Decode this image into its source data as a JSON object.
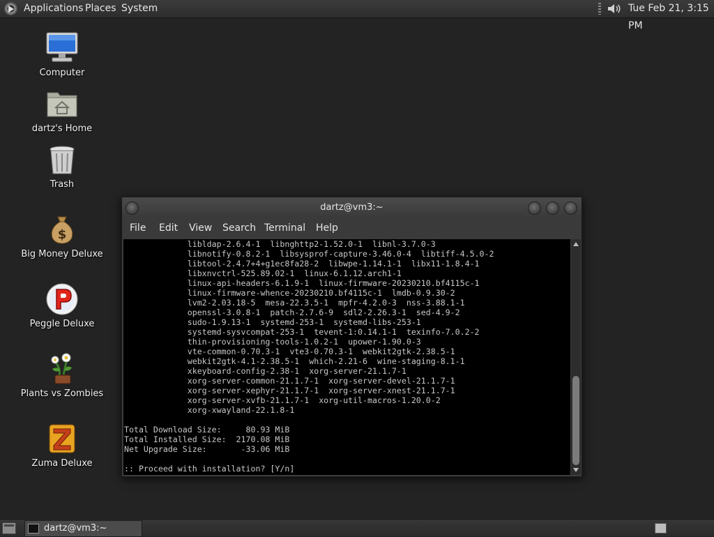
{
  "top_panel": {
    "menu": [
      "Applications",
      "Places",
      "System"
    ],
    "clock": "Tue Feb 21,  3:15 PM"
  },
  "desktop": {
    "icons": [
      {
        "label": "Computer",
        "icon": "computer-icon"
      },
      {
        "label": "dartz's Home",
        "icon": "home-folder-icon"
      },
      {
        "label": "Trash",
        "icon": "trash-icon"
      },
      {
        "label": "Big Money Deluxe",
        "icon": "money-bag-icon"
      },
      {
        "label": "Peggle Deluxe",
        "icon": "peggle-icon"
      },
      {
        "label": "Plants vs Zombies",
        "icon": "plants-vs-zombies-icon"
      },
      {
        "label": "Zuma Deluxe",
        "icon": "zuma-icon"
      }
    ]
  },
  "terminal": {
    "title": "dartz@vm3:~",
    "menu": [
      "File",
      "Edit",
      "View",
      "Search",
      "Terminal",
      "Help"
    ],
    "lines": [
      "             libldap-2.6.4-1  libnghttp2-1.52.0-1  libnl-3.7.0-3",
      "             libnotify-0.8.2-1  libsysprof-capture-3.46.0-4  libtiff-4.5.0-2",
      "             libtool-2.4.7+4+g1ec8fa28-2  libwpe-1.14.1-1  libx11-1.8.4-1",
      "             libxnvctrl-525.89.02-1  linux-6.1.12.arch1-1",
      "             linux-api-headers-6.1.9-1  linux-firmware-20230210.bf4115c-1",
      "             linux-firmware-whence-20230210.bf4115c-1  lmdb-0.9.30-2",
      "             lvm2-2.03.18-5  mesa-22.3.5-1  mpfr-4.2.0-3  nss-3.88.1-1",
      "             openssl-3.0.8-1  patch-2.7.6-9  sdl2-2.26.3-1  sed-4.9-2",
      "             sudo-1.9.13-1  systemd-253-1  systemd-libs-253-1",
      "             systemd-sysvcompat-253-1  tevent-1:0.14.1-1  texinfo-7.0.2-2",
      "             thin-provisioning-tools-1.0.2-1  upower-1.90.0-3",
      "             vte-common-0.70.3-1  vte3-0.70.3-1  webkit2gtk-2.38.5-1",
      "             webkit2gtk-4.1-2.38.5-1  which-2.21-6  wine-staging-8.1-1",
      "             xkeyboard-config-2.38-1  xorg-server-21.1.7-1",
      "             xorg-server-common-21.1.7-1  xorg-server-devel-21.1.7-1",
      "             xorg-server-xephyr-21.1.7-1  xorg-server-xnest-21.1.7-1",
      "             xorg-server-xvfb-21.1.7-1  xorg-util-macros-1.20.0-2",
      "             xorg-xwayland-22.1.8-1",
      "",
      "Total Download Size:     80.93 MiB",
      "Total Installed Size:  2170.08 MiB",
      "Net Upgrade Size:       -33.06 MiB",
      "",
      ":: Proceed with installation? [Y/n]"
    ]
  },
  "bottom_panel": {
    "task": "dartz@vm3:~"
  }
}
